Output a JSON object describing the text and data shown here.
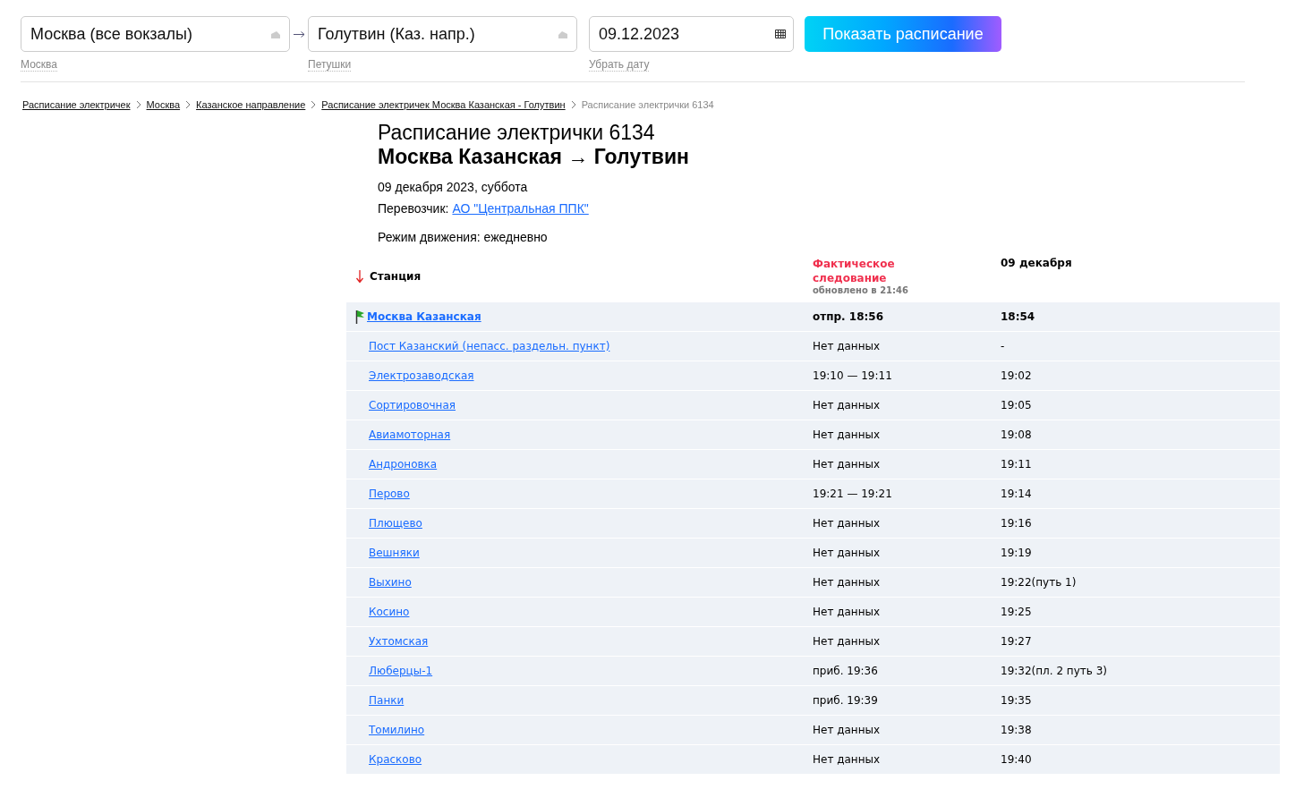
{
  "search": {
    "from": {
      "value": "Москва (все вокзалы)",
      "hint": "Москва"
    },
    "to": {
      "value": "Голутвин (Каз. напр.)",
      "hint": "Петушки"
    },
    "date": {
      "value": "09.12.2023",
      "hint": "Убрать дату"
    },
    "submit": "Показать расписание"
  },
  "breadcrumbs": [
    {
      "label": "Расписание электричек",
      "current": false
    },
    {
      "label": "Москва",
      "current": false
    },
    {
      "label": "Казанское направление",
      "current": false
    },
    {
      "label": "Расписание электричек Москва Казанская - Голутвин",
      "current": false
    },
    {
      "label": "Расписание электрички 6134",
      "current": true
    }
  ],
  "title": "Расписание электрички 6134",
  "route": "Москва Казанская → Голутвин",
  "date_line": "09 декабря 2023, суббота",
  "carrier_label": "Перевозчик:",
  "carrier": "АО \"Центральная ППК\"",
  "mode": "Режим движения: ежедневно",
  "table": {
    "columns": {
      "station": "Станция",
      "actual": "Фактическое следование",
      "updated": "обновлено в 21:46",
      "scheduled": "09 декабря"
    },
    "rows": [
      {
        "kind": "start",
        "station": "Москва Казанская",
        "actual": "отпр. 18:56",
        "scheduled": "18:54"
      },
      {
        "kind": "stop",
        "station": "Пост Казанский (непасс. раздельн. пункт)",
        "actual": "Нет данных",
        "scheduled": "-"
      },
      {
        "kind": "stop",
        "station": "Электрозаводская",
        "actual": "19:10 — 19:11",
        "scheduled": "19:02"
      },
      {
        "kind": "stop",
        "station": "Сортировочная",
        "actual": "Нет данных",
        "scheduled": "19:05"
      },
      {
        "kind": "stop",
        "station": "Авиамоторная",
        "actual": "Нет данных",
        "scheduled": "19:08"
      },
      {
        "kind": "stop",
        "station": "Андроновка",
        "actual": "Нет данных",
        "scheduled": "19:11"
      },
      {
        "kind": "stop",
        "station": "Перово",
        "actual": "19:21 — 19:21",
        "scheduled": "19:14"
      },
      {
        "kind": "stop",
        "station": "Плющево",
        "actual": "Нет данных",
        "scheduled": "19:16"
      },
      {
        "kind": "stop",
        "station": "Вешняки",
        "actual": "Нет данных",
        "scheduled": "19:19"
      },
      {
        "kind": "stop",
        "station": "Выхино",
        "actual": "Нет данных",
        "scheduled": "19:22(путь 1)"
      },
      {
        "kind": "stop",
        "station": "Косино",
        "actual": "Нет данных",
        "scheduled": "19:25"
      },
      {
        "kind": "stop",
        "station": "Ухтомская",
        "actual": "Нет данных",
        "scheduled": "19:27"
      },
      {
        "kind": "stop",
        "station": "Люберцы-1",
        "actual": "приб. 19:36",
        "scheduled": "19:32(пл. 2 путь 3)"
      },
      {
        "kind": "stop",
        "station": "Панки",
        "actual": "приб. 19:39",
        "scheduled": "19:35"
      },
      {
        "kind": "stop",
        "station": "Томилино",
        "actual": "Нет данных",
        "scheduled": "19:38"
      },
      {
        "kind": "stop",
        "station": "Красково",
        "actual": "Нет данных",
        "scheduled": "19:40"
      }
    ]
  }
}
